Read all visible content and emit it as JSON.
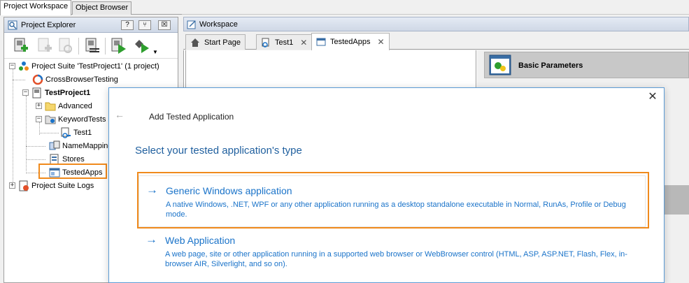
{
  "top_tabs": [
    {
      "label": "Project Workspace"
    },
    {
      "label": "Object Browser"
    }
  ],
  "project_explorer": {
    "title": "Project Explorer",
    "help_label": "?",
    "pin_label": "⑂",
    "close_label": "☒"
  },
  "tree": [
    {
      "label": "Project Suite 'TestProject1' (1 project)"
    },
    {
      "label": "CrossBrowserTesting"
    },
    {
      "label": "TestProject1"
    },
    {
      "label": "Advanced"
    },
    {
      "label": "KeywordTests"
    },
    {
      "label": "Test1"
    },
    {
      "label": "NameMapping"
    },
    {
      "label": "Stores"
    },
    {
      "label": "TestedApps"
    },
    {
      "label": "Project Suite Logs"
    }
  ],
  "workspace": {
    "title": "Workspace",
    "tabs": [
      {
        "label": "Start Page"
      },
      {
        "label": "Test1"
      },
      {
        "label": "TestedApps"
      }
    ],
    "basic_parameters": "Basic Parameters"
  },
  "dialog": {
    "title": "Add Tested Application",
    "heading": "Select your tested application's type",
    "options": [
      {
        "title": "Generic Windows application",
        "description": "A native Windows, .NET, WPF or any other application running as a desktop standalone executable in Normal, RunAs, Profile or Debug mode."
      },
      {
        "title": "Web Application",
        "description": "A web page, site or other application running in a supported web browser or WebBrowser control (HTML, ASP, ASP.NET, Flash, Flex, in-browser AIR, Silverlight, and so on)."
      }
    ]
  },
  "colors": {
    "accent": "#1a73c9",
    "highlight": "#f08a1c",
    "heading": "#1f5f9e"
  }
}
